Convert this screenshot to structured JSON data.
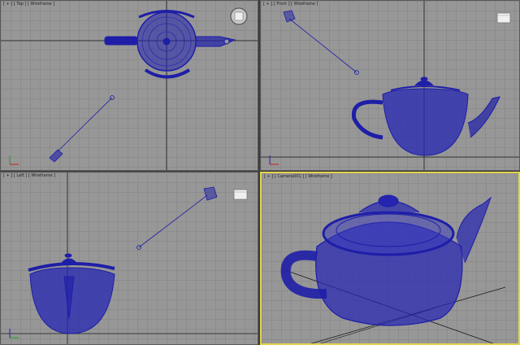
{
  "viewports": {
    "top": {
      "label": "[ + ] [ Top ] [ Wireframe ]",
      "cube_label": "TOP"
    },
    "front": {
      "label": "[ + ] [ Front ] [ Wireframe ]",
      "cube_label": "FRONT"
    },
    "left": {
      "label": "[ + ] [ Left ] [ Wireframe ]",
      "cube_label": "LEFT"
    },
    "camera": {
      "label": "[ + ] [ Camera001 ] [ Wireframe ]"
    }
  },
  "colors": {
    "wireframe": "#1e1ea8",
    "grid_bg": "#979797",
    "active_border": "#e3d34d",
    "axis_line": "#1a1a1a"
  },
  "icons": {
    "viewcube": "viewcube-icon",
    "axis_tripod": "axis-tripod-icon",
    "camera": "camera-icon"
  }
}
